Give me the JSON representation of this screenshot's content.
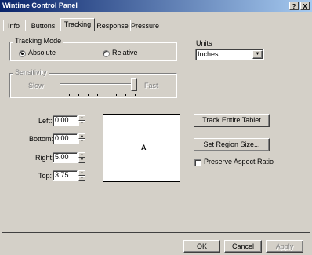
{
  "window": {
    "title": "Wintime Control Panel",
    "help_label": "?",
    "close_label": "X"
  },
  "tabs": [
    {
      "label": "Info"
    },
    {
      "label": "Buttons"
    },
    {
      "label": "Tracking"
    },
    {
      "label": "Response"
    },
    {
      "label": "Pressure"
    }
  ],
  "active_tab": "Tracking",
  "tracking_mode": {
    "legend": "Tracking Mode",
    "options": [
      {
        "label": "Absolute",
        "selected": true
      },
      {
        "label": "Relative",
        "selected": false
      }
    ]
  },
  "units": {
    "label": "Units",
    "value": "Inches",
    "dropdown_glyph": "▼"
  },
  "sensitivity": {
    "legend": "Sensitivity",
    "min_label": "Slow",
    "max_label": "Fast",
    "level": 0.93,
    "enabled": false
  },
  "region": {
    "fields": [
      {
        "label": "Left:",
        "value": "0.00"
      },
      {
        "label": "Bottom:",
        "value": "0.00"
      },
      {
        "label": "Right:",
        "value": "5.00"
      },
      {
        "label": "Top:",
        "value": "3.75"
      }
    ],
    "spin_up": "▲",
    "spin_down": "▼",
    "preview_label": "A"
  },
  "buttons": {
    "track_entire": "Track Entire Tablet",
    "set_region": "Set Region Size...",
    "ok": "OK",
    "cancel": "Cancel",
    "apply": "Apply"
  },
  "preserve_aspect": {
    "label": "Preserve Aspect Ratio",
    "checked": false
  }
}
